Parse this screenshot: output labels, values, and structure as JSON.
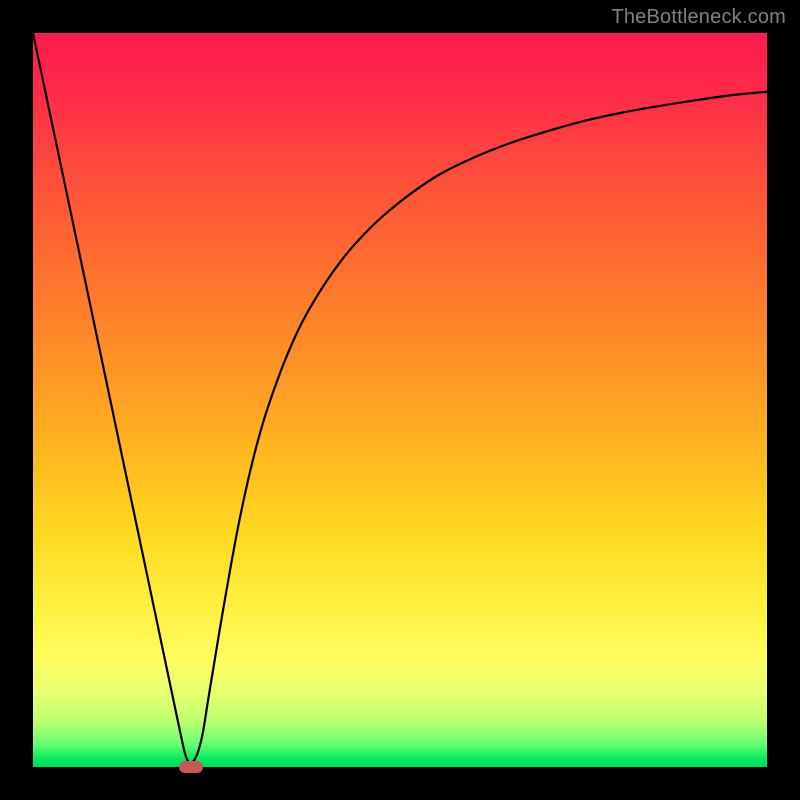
{
  "watermark": "TheBottleneck.com",
  "colors": {
    "frame": "#000000",
    "gradient_top": "#ff1a4f",
    "gradient_bottom": "#00d858",
    "curve": "#000000",
    "marker": "#c95858",
    "watermark": "#808080"
  },
  "chart_data": {
    "type": "line",
    "title": "",
    "xlabel": "",
    "ylabel": "",
    "xlim": [
      0,
      100
    ],
    "ylim": [
      0,
      100
    ],
    "grid": false,
    "legend": false,
    "series": [
      {
        "name": "curve",
        "x": [
          0,
          2,
          4,
          6,
          8,
          10,
          12,
          14,
          16,
          18,
          20,
          21,
          22,
          23,
          24,
          26,
          28,
          30,
          32,
          35,
          38,
          42,
          46,
          50,
          55,
          60,
          65,
          70,
          75,
          80,
          85,
          90,
          95,
          100
        ],
        "values": [
          100,
          90.5,
          81,
          71.5,
          62,
          52.5,
          43,
          33.5,
          24,
          14.5,
          5,
          1,
          1,
          4,
          10,
          22,
          33,
          42,
          49,
          57,
          63,
          69,
          73.5,
          77,
          80.5,
          83,
          85,
          86.6,
          88,
          89.1,
          90,
          90.8,
          91.5,
          92
        ]
      }
    ],
    "marker": {
      "x": 21.5,
      "y": 0,
      "width_frac": 0.033,
      "height_frac": 0.017
    }
  }
}
